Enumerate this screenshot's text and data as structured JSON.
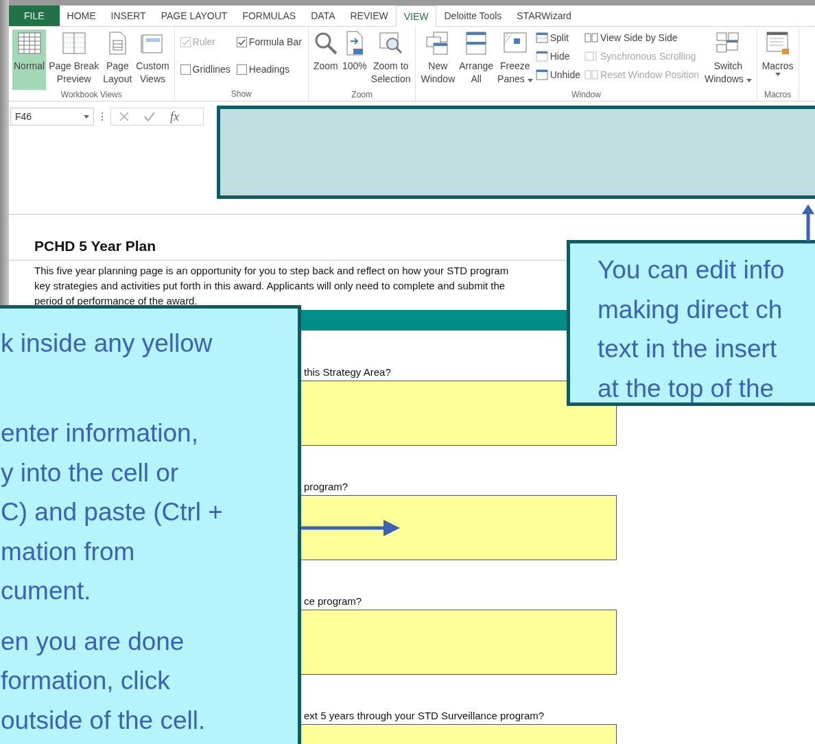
{
  "tabs": [
    {
      "label": "FILE",
      "kind": "file",
      "selected": false
    },
    {
      "label": "HOME",
      "kind": "tab",
      "selected": false
    },
    {
      "label": "INSERT",
      "kind": "tab",
      "selected": false
    },
    {
      "label": "PAGE LAYOUT",
      "kind": "tab",
      "selected": false
    },
    {
      "label": "FORMULAS",
      "kind": "tab",
      "selected": false
    },
    {
      "label": "DATA",
      "kind": "tab",
      "selected": false
    },
    {
      "label": "REVIEW",
      "kind": "tab",
      "selected": false
    },
    {
      "label": "VIEW",
      "kind": "tab",
      "selected": true
    },
    {
      "label": "Deloitte Tools",
      "kind": "tab",
      "selected": false
    },
    {
      "label": "STARWizard",
      "kind": "tab",
      "selected": false
    }
  ],
  "ribbon": [
    {
      "label": "Workbook Views",
      "columns": [
        [
          {
            "kind": "grid",
            "label": "Normal",
            "selected": true
          }
        ],
        [
          {
            "kind": "pagebreak",
            "label": "Page Break\nPreview",
            "selected": false
          }
        ],
        [
          {
            "kind": "page",
            "label": "Page\nLayout",
            "selected": false
          }
        ],
        [
          {
            "kind": "views",
            "label": "Custom\nViews",
            "selected": false
          }
        ]
      ]
    },
    {
      "label": "Show",
      "columns": [
        [
          {
            "kind": "check",
            "label": "Ruler",
            "checked": true,
            "disabled": true
          },
          {
            "kind": "check",
            "label": "Gridlines",
            "checked": false,
            "disabled": false
          }
        ],
        [
          {
            "kind": "check",
            "label": "Formula Bar",
            "checked": true,
            "disabled": false
          },
          {
            "kind": "check",
            "label": "Headings",
            "checked": false,
            "disabled": false
          }
        ]
      ]
    },
    {
      "label": "Zoom",
      "columns": [
        [
          {
            "kind": "zoom",
            "label": "Zoom"
          }
        ],
        [
          {
            "kind": "hundred",
            "label": "100%"
          }
        ],
        [
          {
            "kind": "zoomsel",
            "label": "Zoom to\nSelection"
          }
        ]
      ]
    },
    {
      "label": "Window",
      "columns": [
        [
          {
            "kind": "newwin",
            "label": "New\nWindow"
          }
        ],
        [
          {
            "kind": "arrange",
            "label": "Arrange\nAll"
          }
        ],
        [
          {
            "kind": "freeze",
            "label": "Freeze\nPanes",
            "dropdown": true
          }
        ],
        [
          {
            "kind": "split",
            "label": "Split",
            "disabled": false
          },
          {
            "kind": "hide",
            "label": "Hide",
            "disabled": false
          },
          {
            "kind": "unhide",
            "label": "Unhide",
            "disabled": false
          }
        ],
        [
          {
            "kind": "side",
            "label": "View Side by Side",
            "disabled": false
          },
          {
            "kind": "sync",
            "label": "Synchronous Scrolling",
            "disabled": true
          },
          {
            "kind": "reset",
            "label": "Reset Window Position",
            "disabled": true
          }
        ],
        [
          {
            "kind": "switch",
            "label": "Switch\nWindows",
            "dropdown": true
          }
        ]
      ]
    },
    {
      "label": "Macros",
      "columns": [
        [
          {
            "kind": "macros",
            "label": "Macros",
            "dropdown": true
          }
        ]
      ]
    }
  ],
  "formula_bar": {
    "name_box": "F46",
    "fx": "fx"
  },
  "sheet": {
    "title": "PCHD 5 Year Plan",
    "intro": "This five year planning page is an opportunity for you to step back and reflect on how your STD program\nkey strategies and activities put forth in this award. Applicants will only need to complete and submit the\nperiod of performance of the award.",
    "questions": [
      {
        "text": "this Strategy Area?"
      },
      {
        "text": "program?"
      },
      {
        "text": "ce program?"
      },
      {
        "text": "ext 5 years through your STD Surveillance program?"
      }
    ]
  },
  "callouts": [
    {
      "kind": "left",
      "paragraphs": [
        "k inside any yellow\n ",
        "enter information,\ny into the cell or\nC) and paste (Ctrl +\nmation from\ncument.",
        "en you are done\nformation, click\noutside of the cell."
      ]
    },
    {
      "kind": "right",
      "paragraphs": [
        "You can edit info\nmaking direct ch\ntext in the insert\nat the top of the"
      ]
    }
  ]
}
